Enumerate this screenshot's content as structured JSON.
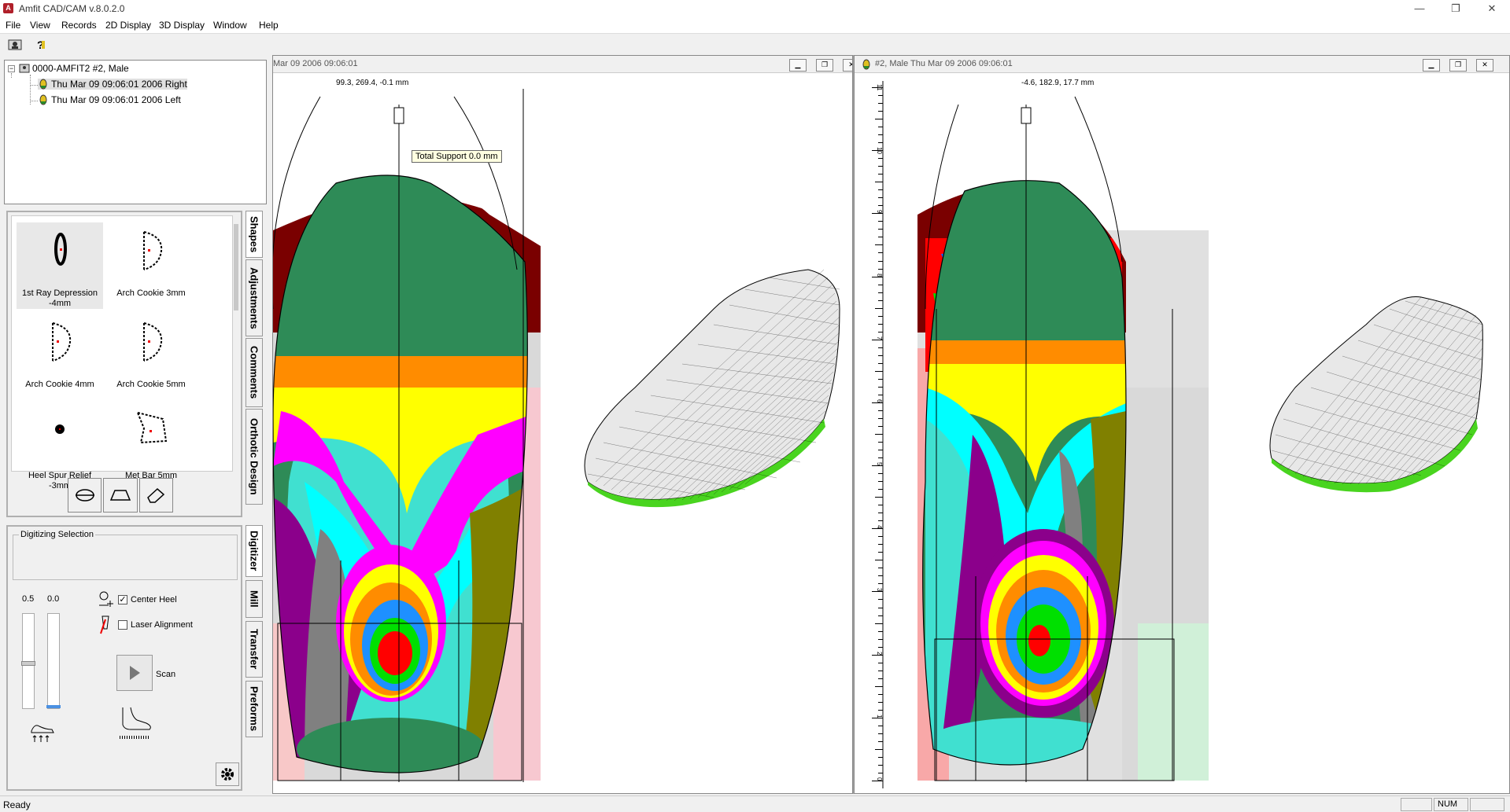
{
  "window": {
    "title": "Amfit CAD/CAM v.8.0.2.0",
    "icon_letter": "A"
  },
  "menu": [
    "File",
    "View",
    "Records",
    "2D Display",
    "3D Display",
    "Window",
    "Help"
  ],
  "tree": {
    "root": "0000-AMFIT2  #2, Male",
    "children": [
      "Thu Mar 09 09:06:01 2006 Right",
      "Thu Mar 09 09:06:01 2006 Left"
    ]
  },
  "shapes": [
    {
      "label": "1st Ray Depression -4mm",
      "icon": "oval-pad-icon"
    },
    {
      "label": "Arch Cookie 3mm",
      "icon": "arch-cookie-icon"
    },
    {
      "label": "Arch Cookie 4mm",
      "icon": "arch-cookie-icon"
    },
    {
      "label": "Arch Cookie 5mm",
      "icon": "arch-cookie-icon"
    },
    {
      "label": "Heel Spur Relief -3mm",
      "icon": "dot-icon"
    },
    {
      "label": "Met Bar 5mm",
      "icon": "met-bar-icon"
    }
  ],
  "side_tabs_top": [
    "Shapes",
    "Adjustments",
    "Comments",
    "Orthotic Design"
  ],
  "side_tabs_bottom": [
    "Digitizer",
    "Mill",
    "Transfer",
    "Preforms"
  ],
  "digitizer": {
    "group_label": "Digitizing Selection",
    "slider1_value": "0.5",
    "slider2_value": "0.0",
    "center_heel_label": "Center Heel",
    "center_heel_checked": true,
    "laser_label": "Laser Alignment",
    "laser_checked": false,
    "scan_label": "Scan"
  },
  "left_view": {
    "title": "Mar 09 2006 09:06:01",
    "coord": "99.3, 269.4, -0.1 mm",
    "tooltip": "Total Support 0.0 mm"
  },
  "right_view": {
    "title": "#2, Male  Thu Mar 09 2006 09:06:01",
    "coord": "-4.6, 182.9, 17.7 mm",
    "ruler_labels": [
      "11",
      "10",
      "9",
      "8",
      "7",
      "6",
      "5",
      "4",
      "3",
      "2",
      "1",
      "0"
    ]
  },
  "status": {
    "text": "Ready",
    "num": "NUM"
  },
  "colors": {
    "contour": [
      "#7a0000",
      "#ff0000",
      "#1464ff",
      "#00e000",
      "#1e90ff",
      "#ff8c00",
      "#ffff00",
      "#ff00ff",
      "#00ffff",
      "#8b008b",
      "#808080",
      "#40e0d0",
      "#808000",
      "#2e8b57",
      "#f08080",
      "#ffe4e1"
    ]
  }
}
